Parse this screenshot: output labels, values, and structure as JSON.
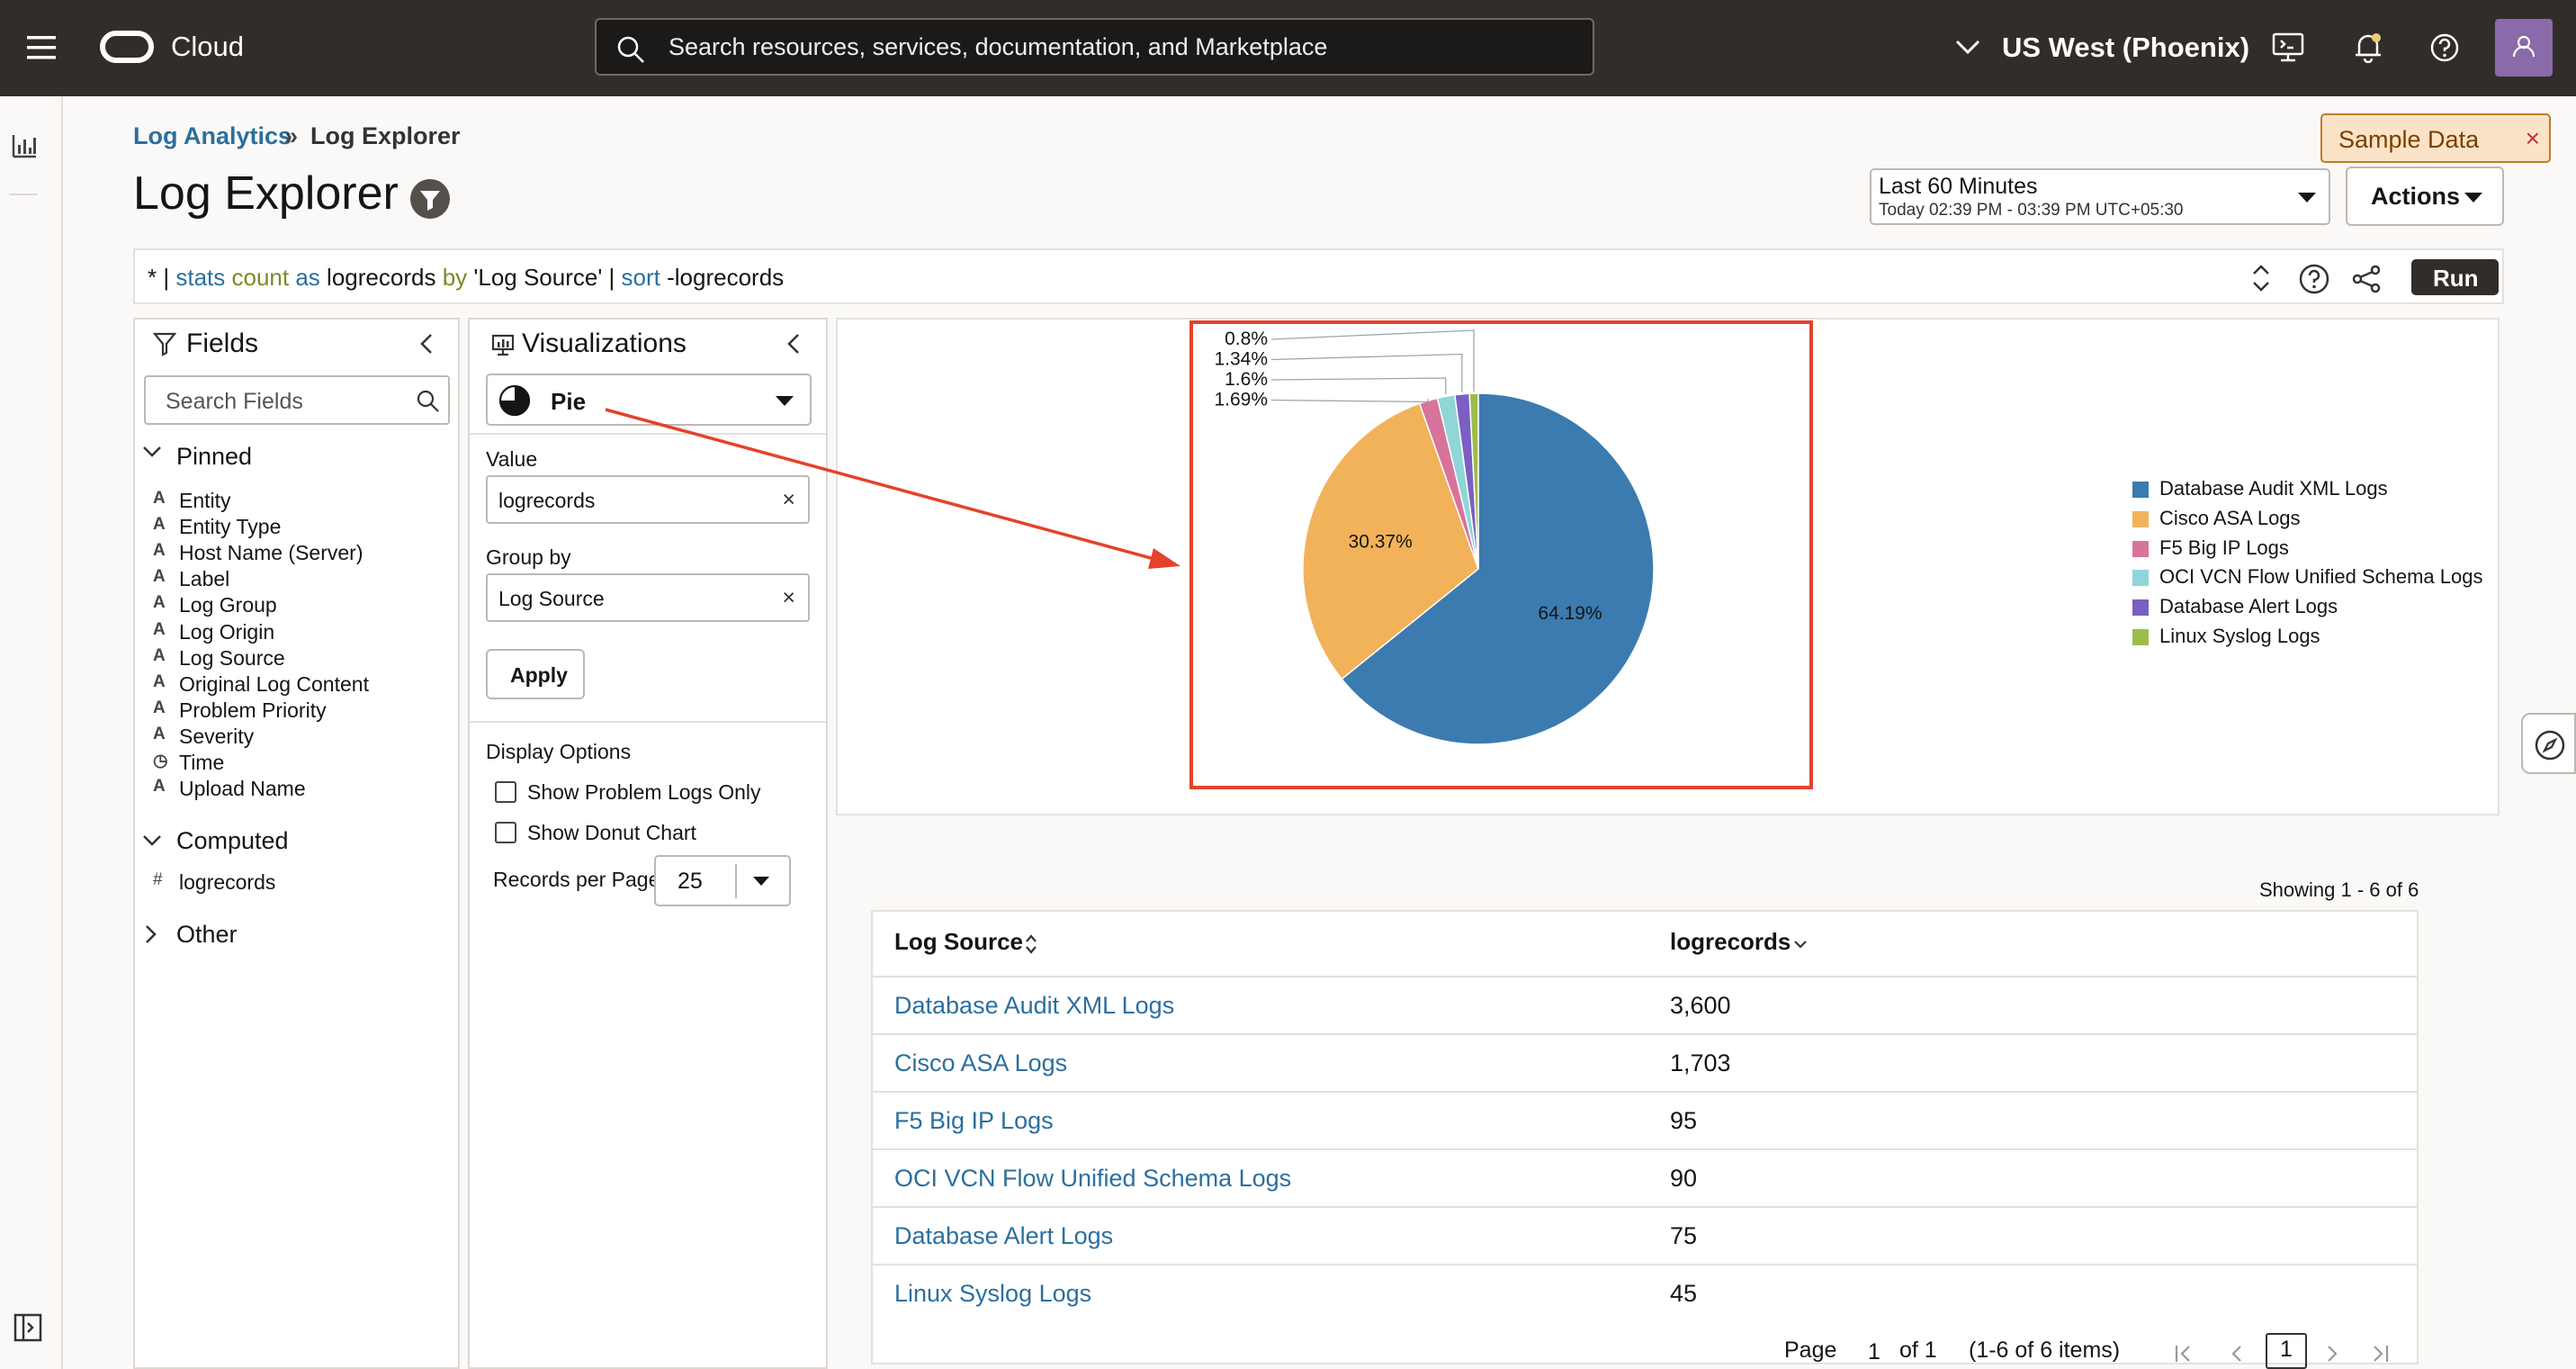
{
  "header": {
    "app_name": "Cloud",
    "search_placeholder": "Search resources, services, documentation, and Marketplace",
    "region": "US West (Phoenix)"
  },
  "breadcrumb": {
    "parent": "Log Analytics",
    "separator": "»",
    "current": "Log Explorer"
  },
  "page_title": "Log Explorer",
  "sample_data_label": "Sample Data",
  "time_range": {
    "label": "Last 60 Minutes",
    "detail": "Today 02:39 PM - 03:39 PM UTC+05:30"
  },
  "actions_label": "Actions",
  "query": {
    "prefix": "* |",
    "kw1": "stats",
    "fn": "count",
    "kw_as": "as",
    "alias": "logrecords",
    "kw_by": "by",
    "field": "'Log Source'",
    "pipe": "|",
    "kw_sort": "sort",
    "sort_expr": "-logrecords"
  },
  "run_label": "Run",
  "fields_panel": {
    "title": "Fields",
    "search_placeholder": "Search Fields",
    "pinned_label": "Pinned",
    "pinned": [
      {
        "type": "A",
        "label": "Entity"
      },
      {
        "type": "A",
        "label": "Entity Type"
      },
      {
        "type": "A",
        "label": "Host Name (Server)"
      },
      {
        "type": "A",
        "label": "Label"
      },
      {
        "type": "A",
        "label": "Log Group"
      },
      {
        "type": "A",
        "label": "Log Origin"
      },
      {
        "type": "A",
        "label": "Log Source"
      },
      {
        "type": "A",
        "label": "Original Log Content"
      },
      {
        "type": "A",
        "label": "Problem Priority"
      },
      {
        "type": "A",
        "label": "Severity"
      },
      {
        "type": "◷",
        "label": "Time"
      },
      {
        "type": "A",
        "label": "Upload Name"
      }
    ],
    "computed_label": "Computed",
    "computed": [
      {
        "type": "#",
        "label": "logrecords"
      }
    ],
    "other_label": "Other"
  },
  "viz_panel": {
    "title": "Visualizations",
    "type": "Pie",
    "value_label": "Value",
    "value": "logrecords",
    "groupby_label": "Group by",
    "groupby": "Log Source",
    "apply_label": "Apply",
    "display_options_label": "Display Options",
    "opt_problem": "Show Problem Logs Only",
    "opt_donut": "Show Donut Chart",
    "records_label": "Records per Page",
    "records_value": "25"
  },
  "colors": {
    "accent": "#e3432b",
    "link": "#2c6f9e",
    "topbar": "#312d2a",
    "run": "#312d2a"
  },
  "chart_data": {
    "type": "pie",
    "categories": [
      "Database Audit XML Logs",
      "Cisco ASA Logs",
      "F5 Big IP Logs",
      "OCI VCN Flow Unified Schema Logs",
      "Database Alert Logs",
      "Linux Syslog Logs"
    ],
    "values": [
      3600,
      1703,
      95,
      90,
      75,
      45
    ],
    "labels": [
      "64.19%",
      "30.37%",
      "1.69%",
      "1.6%",
      "1.34%",
      "0.8%"
    ],
    "colors": [
      "#3b7bb0",
      "#f2b25a",
      "#d8739c",
      "#8fd6d8",
      "#7b5fc2",
      "#9bbd4a"
    ],
    "legend_position": "right"
  },
  "table": {
    "showing": "Showing 1 - 6 of 6",
    "col1": "Log Source",
    "col2": "logrecords",
    "rows": [
      {
        "source": "Database Audit XML Logs",
        "count": "3,600"
      },
      {
        "source": "Cisco ASA Logs",
        "count": "1,703"
      },
      {
        "source": "F5 Big IP Logs",
        "count": "95"
      },
      {
        "source": "OCI VCN Flow Unified Schema Logs",
        "count": "90"
      },
      {
        "source": "Database Alert Logs",
        "count": "75"
      },
      {
        "source": "Linux Syslog Logs",
        "count": "45"
      }
    ],
    "pager": {
      "page_label": "Page",
      "page": "1",
      "of": "of 1",
      "items": "(1-6 of 6 items)",
      "current": "1"
    }
  }
}
